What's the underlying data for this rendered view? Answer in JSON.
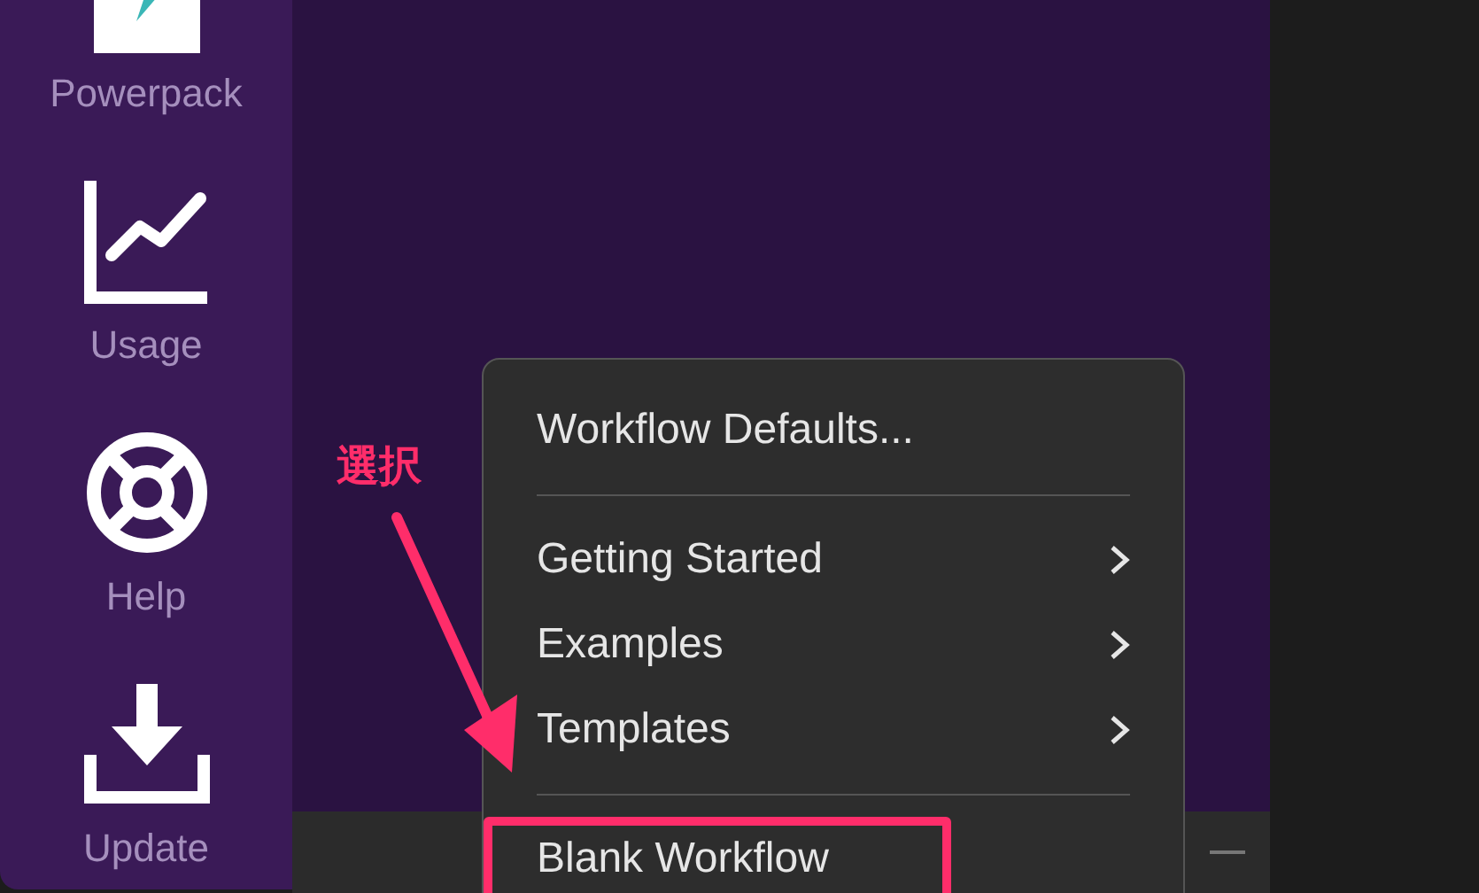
{
  "sidebar": {
    "items": [
      {
        "label": "Powerpack"
      },
      {
        "label": "Usage"
      },
      {
        "label": "Help"
      },
      {
        "label": "Update"
      }
    ]
  },
  "menu": {
    "items": [
      {
        "kind": "item",
        "label": "Workflow Defaults...",
        "highlighted": false
      },
      {
        "kind": "divider"
      },
      {
        "kind": "submenu",
        "label": "Getting Started",
        "highlighted": false
      },
      {
        "kind": "submenu",
        "label": "Examples",
        "highlighted": false
      },
      {
        "kind": "submenu",
        "label": "Templates",
        "highlighted": false
      },
      {
        "kind": "divider"
      },
      {
        "kind": "item",
        "label": "Blank Workflow",
        "highlighted": true
      }
    ]
  },
  "annotation": {
    "label": "選択"
  }
}
